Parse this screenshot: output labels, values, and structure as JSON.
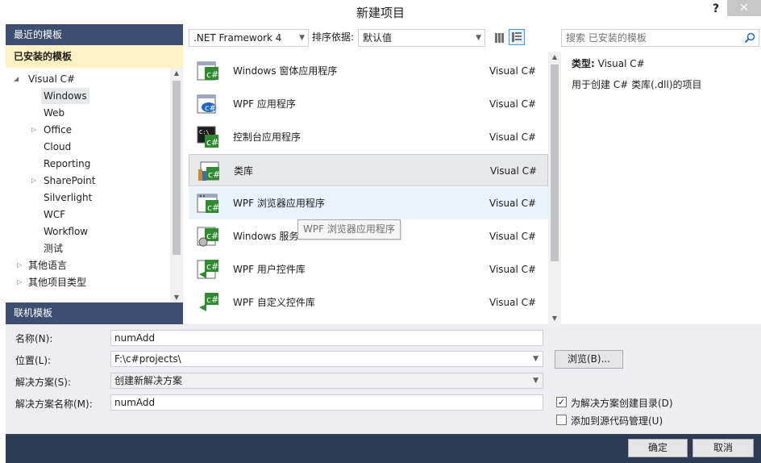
{
  "window": {
    "title": "新建项目",
    "help": "?",
    "close": "✕"
  },
  "left": {
    "recent": "最近的模板",
    "installed": "已安装的模板",
    "tree": [
      {
        "label": "Visual C#",
        "arrow": "◢"
      },
      {
        "label": "Windows"
      },
      {
        "label": "Web"
      },
      {
        "label": "Office",
        "arrow": "▷"
      },
      {
        "label": "Cloud"
      },
      {
        "label": "Reporting"
      },
      {
        "label": "SharePoint",
        "arrow": "▷"
      },
      {
        "label": "Silverlight"
      },
      {
        "label": "WCF"
      },
      {
        "label": "Workflow"
      },
      {
        "label": "测试"
      },
      {
        "label": "其他语言",
        "arrow": "▷"
      },
      {
        "label": "其他项目类型",
        "arrow": "▷"
      }
    ],
    "online": "联机模板"
  },
  "toolbar": {
    "framework": ".NET Framework 4",
    "sort_label": "排序依据:",
    "sort_value": "默认值",
    "search_placeholder": "搜索 已安装的模板"
  },
  "templates": [
    {
      "name": "Windows 窗体应用程序",
      "lang": "Visual C#",
      "icon": "winforms-icon"
    },
    {
      "name": "WPF 应用程序",
      "lang": "Visual C#",
      "icon": "wpf-app-icon"
    },
    {
      "name": "控制台应用程序",
      "lang": "Visual C#",
      "icon": "console-icon"
    },
    {
      "name": "类库",
      "lang": "Visual C#",
      "icon": "class-library-icon"
    },
    {
      "name": "WPF 浏览器应用程序",
      "lang": "Visual C#",
      "icon": "wpf-browser-icon"
    },
    {
      "name": "Windows 服务",
      "lang": "Visual C#",
      "icon": "windows-service-icon"
    },
    {
      "name": "WPF 用户控件库",
      "lang": "Visual C#",
      "icon": "wpf-usercontrol-icon"
    },
    {
      "name": "WPF 自定义控件库",
      "lang": "Visual C#",
      "icon": "wpf-customcontrol-icon"
    }
  ],
  "tooltip": "WPF 浏览器应用程序",
  "info": {
    "type_label": "类型:",
    "type_value": "Visual C#",
    "description": "用于创建 C# 类库(.dll)的项目"
  },
  "form": {
    "name_label": "名称(N):",
    "name_value": "numAdd",
    "location_label": "位置(L):",
    "location_value": "F:\\c#projects\\",
    "solution_label": "解决方案(S):",
    "solution_value": "创建新解决方案",
    "solution_name_label": "解决方案名称(M):",
    "solution_name_value": "numAdd",
    "browse": "浏览(B)...",
    "create_dir_label": "为解决方案创建目录(D)",
    "create_dir_checked": true,
    "source_control_label": "添加到源代码管理(U)",
    "source_control_checked": false
  },
  "buttons": {
    "ok": "确定",
    "cancel": "取消"
  }
}
